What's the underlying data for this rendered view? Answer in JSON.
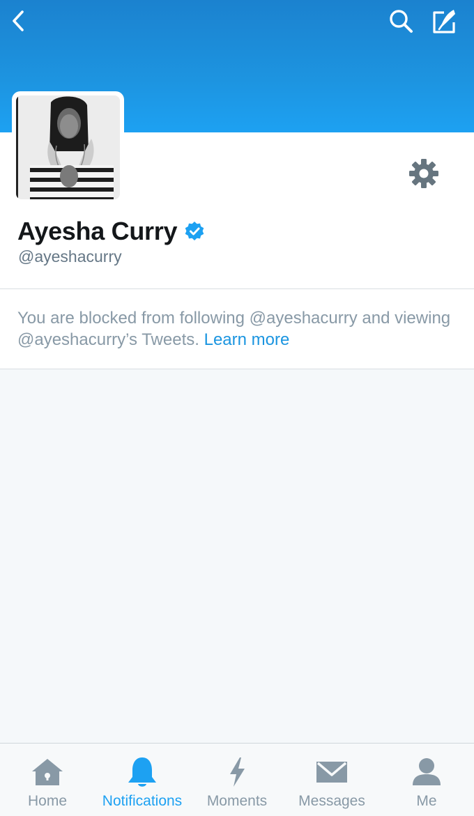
{
  "header": {
    "back_icon": "chevron-left-icon",
    "search_icon": "search-icon",
    "compose_icon": "compose-tweet-icon",
    "background_color": "#1da1f2"
  },
  "profile": {
    "display_name": "Ayesha Curry",
    "handle": "@ayeshacurry",
    "verified": true,
    "verified_icon": "verified-badge-icon",
    "settings_icon": "gear-icon"
  },
  "blocked_notice": {
    "message": "You are blocked from following @ayeshacurry and viewing @ayeshacurry’s Tweets.",
    "link_label": "Learn more",
    "link_color": "#1b95e0"
  },
  "tabbar": {
    "active_color": "#1da1f2",
    "inactive_color": "#8899a6",
    "tabs": [
      {
        "label": "Home",
        "icon": "home-icon",
        "active": false
      },
      {
        "label": "Notifications",
        "icon": "bell-icon",
        "active": true
      },
      {
        "label": "Moments",
        "icon": "lightning-icon",
        "active": false
      },
      {
        "label": "Messages",
        "icon": "envelope-icon",
        "active": false
      },
      {
        "label": "Me",
        "icon": "person-icon",
        "active": false
      }
    ]
  }
}
